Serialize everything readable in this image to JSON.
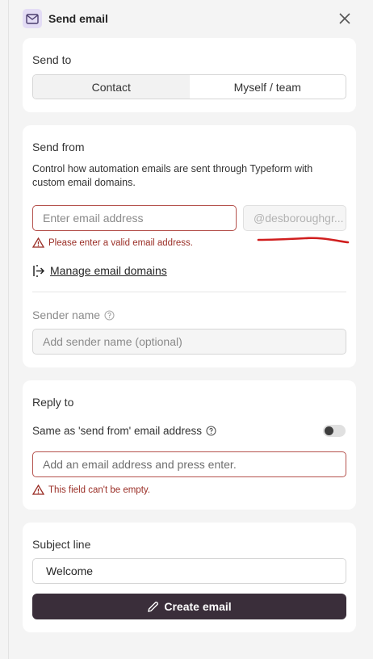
{
  "header": {
    "title": "Send email",
    "icon": "envelope-icon",
    "close_icon": "close-icon"
  },
  "send_to": {
    "title": "Send to",
    "options": [
      "Contact",
      "Myself / team"
    ],
    "selected": "Contact"
  },
  "send_from": {
    "title": "Send from",
    "description": "Control how automation emails are sent through Typeform with custom email domains.",
    "email_placeholder": "Enter email address",
    "domain_value": "@desboroughgr...",
    "error": "Please enter a valid email address.",
    "manage_link": "Manage email domains",
    "sender_label": "Sender name",
    "sender_placeholder": "Add sender name (optional)"
  },
  "reply_to": {
    "title": "Reply to",
    "same_label": "Same as 'send from' email address",
    "toggle_on": false,
    "input_placeholder": "Add an email address and press enter.",
    "error": "This field can't be empty."
  },
  "subject": {
    "title": "Subject line",
    "value": "Welcome",
    "create_button": "Create email"
  },
  "colors": {
    "accent_dark": "#3a2e3a",
    "error": "#9a2e26",
    "annotation": "#d01e1e"
  }
}
